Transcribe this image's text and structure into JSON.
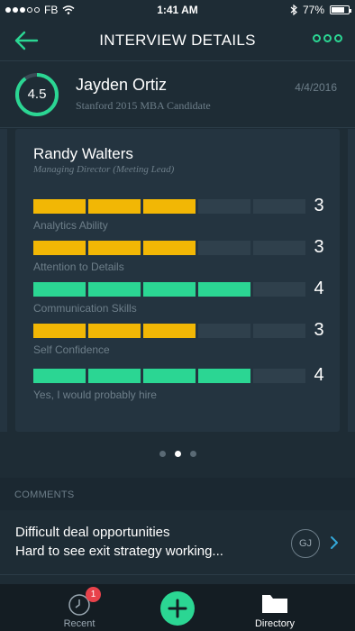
{
  "status_bar": {
    "carrier": "FB",
    "time": "1:41 AM",
    "battery_text": "77%",
    "battery_level": 0.77
  },
  "header": {
    "title": "INTERVIEW DETAILS",
    "back_icon": "arrow-left-icon",
    "more_icon": "more-dots-icon"
  },
  "candidate": {
    "score": "4.5",
    "score_fraction": 0.9,
    "name": "Jayden Ortiz",
    "subtitle": "Stanford 2015 MBA Candidate",
    "date": "4/4/2016"
  },
  "interviewer": {
    "name": "Randy Walters",
    "role": "Managing Director (Meeting Lead)"
  },
  "ratings": [
    {
      "label": "Analytics Ability",
      "value": "3",
      "score": 3,
      "max": 5,
      "color": "#f2b705"
    },
    {
      "label": "Attention to Details",
      "value": "3",
      "score": 3,
      "max": 5,
      "color": "#f2b705"
    },
    {
      "label": "Communication Skills",
      "value": "4",
      "score": 4,
      "max": 5,
      "color": "#2bd693"
    },
    {
      "label": "Self Confidence",
      "value": "3",
      "score": 3,
      "max": 5,
      "color": "#f2b705"
    },
    {
      "label": "Yes, I would probably hire",
      "value": "4",
      "score": 4,
      "max": 5,
      "color": "#2bd693"
    }
  ],
  "pager": {
    "count": 3,
    "active": 1
  },
  "comments": {
    "label": "COMMENTS",
    "items": [
      {
        "title": "Difficult deal opportunities",
        "text": "Hard to see exit strategy working...",
        "initials": "GJ"
      }
    ]
  },
  "tab_bar": {
    "recent_label": "Recent",
    "recent_badge": "1",
    "directory_label": "Directory"
  },
  "colors": {
    "background": "#1e2c35",
    "card": "#243440",
    "accent_green": "#2bd693",
    "accent_yellow": "#f2b705",
    "muted_text": "#6d7e89",
    "badge_red": "#e8424b"
  }
}
